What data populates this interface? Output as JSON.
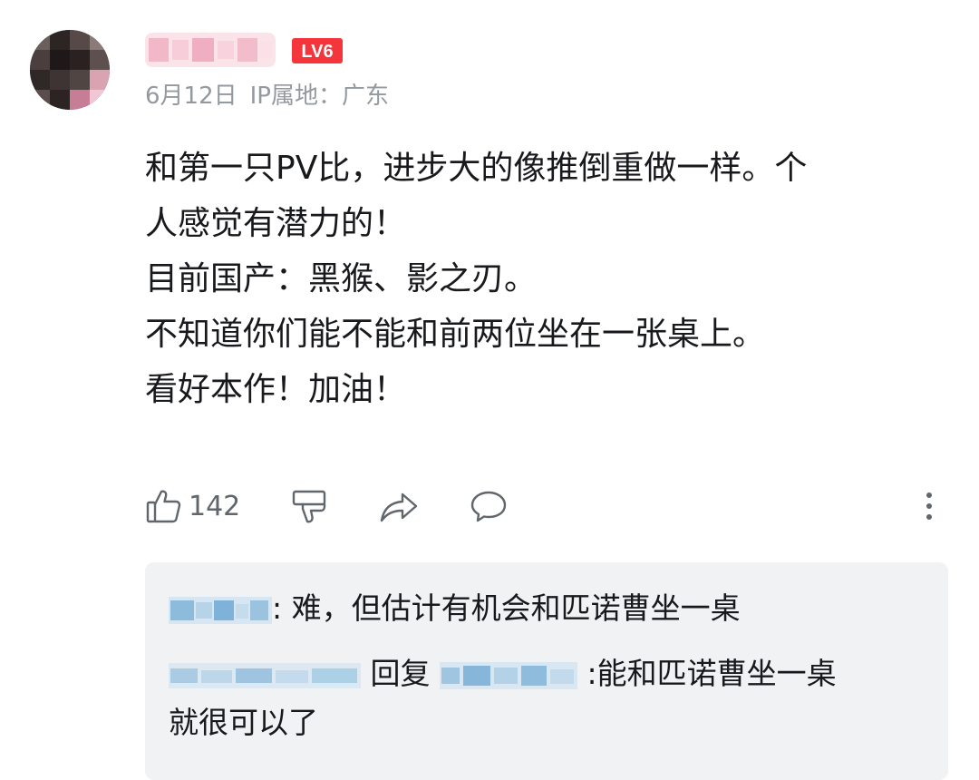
{
  "comment": {
    "level_badge": "LV6",
    "date": "6月12日",
    "ip_location": "IP属地：广东",
    "content_lines": [
      "和第一只PV比，进步大的像推倒重做一样。个",
      "人感觉有潜力的！",
      "目前国产：黑猴、影之刃。",
      "不知道你们能不能和前两位坐在一张桌上。",
      "看好本作！加油！"
    ],
    "like_count": "142"
  },
  "icons": {
    "like": "thumbs-up-icon",
    "dislike": "thumbs-down-icon",
    "share": "share-icon",
    "reply": "comment-icon",
    "more": "more-vertical-icon"
  },
  "replies": [
    {
      "text": ": 难，但估计有机会和匹诺曹坐一桌"
    },
    {
      "reply_word": "回复",
      "text_line1": " :能和匹诺曹坐一桌",
      "text_line2": "就很可以了"
    }
  ],
  "colors": {
    "text": "#18191c",
    "muted": "#9499a0",
    "icon": "#61666d",
    "level_badge": "#f4353b",
    "reply_bg": "#f1f2f3",
    "reply_name_blur": "#7fb2d8"
  }
}
